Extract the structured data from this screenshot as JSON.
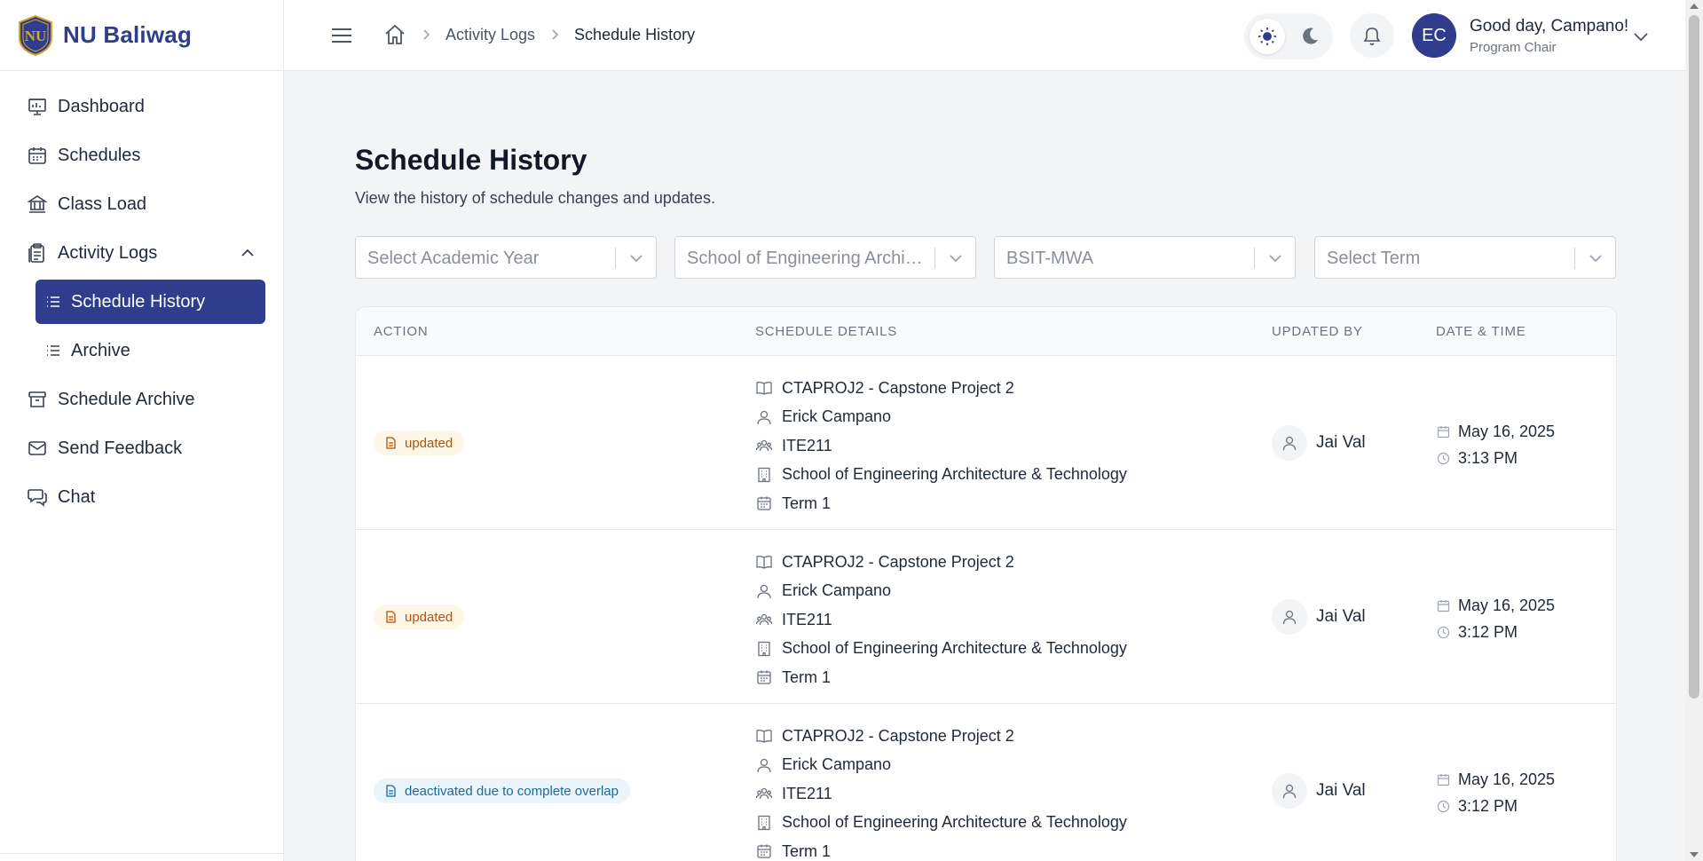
{
  "brand": {
    "name": "NU Baliwag"
  },
  "sidebar": {
    "items": [
      {
        "label": "Dashboard",
        "icon": "dashboard-icon"
      },
      {
        "label": "Schedules",
        "icon": "calendar-icon"
      },
      {
        "label": "Class Load",
        "icon": "building-icon"
      },
      {
        "label": "Activity Logs",
        "icon": "clipboard-icon",
        "expanded": true
      },
      {
        "label": "Schedule History",
        "icon": "list-icon",
        "active": true
      },
      {
        "label": "Archive",
        "icon": "list-icon"
      },
      {
        "label": "Schedule Archive",
        "icon": "archive-icon"
      },
      {
        "label": "Send Feedback",
        "icon": "mail-icon"
      },
      {
        "label": "Chat",
        "icon": "chat-icon"
      }
    ]
  },
  "header": {
    "breadcrumb": {
      "link": "Activity Logs",
      "current": "Schedule History"
    },
    "avatar_initials": "EC",
    "greeting": "Good day, Campano!",
    "role": "Program Chair"
  },
  "page": {
    "title": "Schedule History",
    "subtitle": "View the history of schedule changes and updates."
  },
  "filters": {
    "academic_year": "Select Academic Year",
    "school": "School of Engineering Architecture & Technology",
    "program": "BSIT-MWA",
    "term": "Select Term"
  },
  "table": {
    "headers": {
      "action": "ACTION",
      "details": "SCHEDULE DETAILS",
      "updated_by": "UPDATED BY",
      "datetime": "DATE & TIME"
    },
    "rows": [
      {
        "action": "updated",
        "course": "CTAPROJ2 - Capstone Project 2",
        "faculty": "Erick Campano",
        "section": "ITE211",
        "school": "School of Engineering Architecture & Technology",
        "term": "Term 1",
        "updated_by": "Jai Val",
        "date": "May 16, 2025",
        "time": "3:13 PM"
      },
      {
        "action": "updated",
        "course": "CTAPROJ2 - Capstone Project 2",
        "faculty": "Erick Campano",
        "section": "ITE211",
        "school": "School of Engineering Architecture & Technology",
        "term": "Term 1",
        "updated_by": "Jai Val",
        "date": "May 16, 2025",
        "time": "3:12 PM"
      },
      {
        "action": "deactivated due to complete overlap",
        "course": "CTAPROJ2 - Capstone Project 2",
        "faculty": "Erick Campano",
        "section": "ITE211",
        "school": "School of Engineering Architecture & Technology",
        "term": "Term 1",
        "updated_by": "Jai Val",
        "date": "May 16, 2025",
        "time": "3:12 PM"
      }
    ]
  },
  "colors": {
    "brand": "#2f3d8c",
    "updated_badge": "#b45309",
    "deactivated_badge": "#1e6a99"
  }
}
